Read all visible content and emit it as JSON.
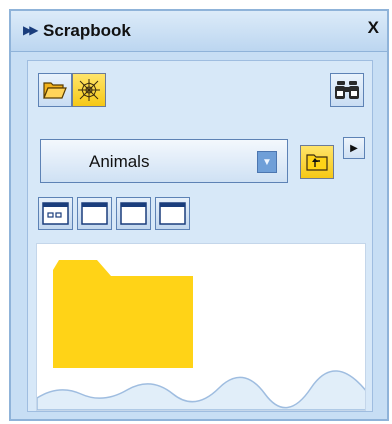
{
  "panel": {
    "title": "Scrapbook",
    "title_icon": "double-arrow-right-icon",
    "close_label": "X"
  },
  "toolbar": {
    "open_folder_icon": "open-folder-icon",
    "web_icon": "spiderweb-icon",
    "search_icon": "binoculars-icon",
    "up_level_icon": "up-level-folder-icon"
  },
  "category": {
    "selected": "Animals"
  },
  "layout_buttons": [
    {
      "icon": "layout-thumbnails-icon"
    },
    {
      "icon": "layout-blank-icon"
    },
    {
      "icon": "layout-blank-icon"
    },
    {
      "icon": "layout-blank-icon"
    }
  ],
  "colors": {
    "folder": "#ffd317",
    "panel_bg": "#c7def4",
    "accent_yellow": "#f6c816"
  }
}
